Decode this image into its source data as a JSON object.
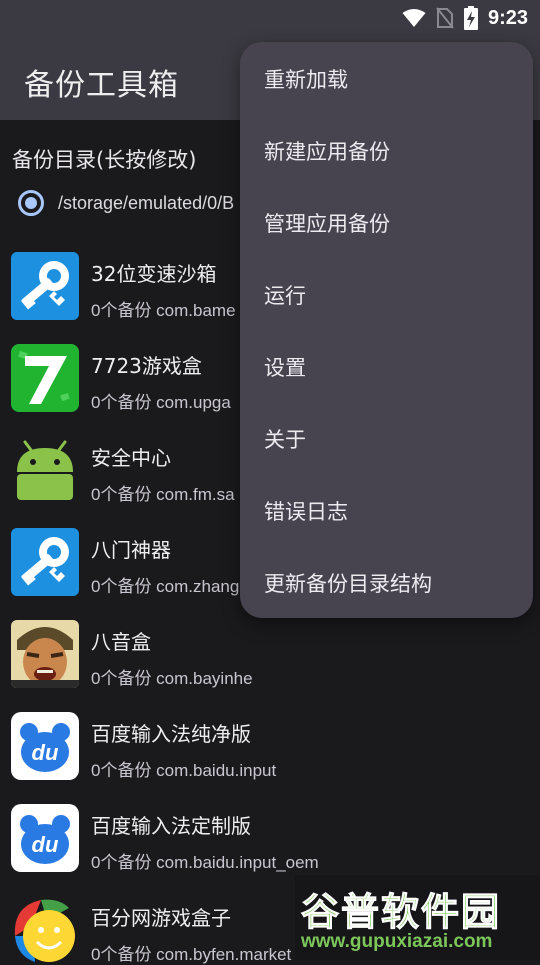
{
  "status_bar": {
    "time": "9:23"
  },
  "app_bar": {
    "title": "备份工具箱"
  },
  "backup_dir": {
    "label": "备份目录(长按修改)",
    "path": "/storage/emulated/0/B"
  },
  "apps": [
    {
      "name": "32位变速沙箱",
      "sub": "0个备份 com.bame",
      "icon": "key-wrench-icon"
    },
    {
      "name": "7723游戏盒",
      "sub": "0个备份 com.upga",
      "icon": "seven-game-icon"
    },
    {
      "name": "安全中心",
      "sub": "0个备份 com.fm.sa",
      "icon": "android-icon"
    },
    {
      "name": "八门神器",
      "sub": "0个备份 com.zhang",
      "icon": "key-wrench-icon"
    },
    {
      "name": "八音盒",
      "sub": "0个备份 com.bayinhe",
      "icon": "character-face-icon"
    },
    {
      "name": "百度输入法纯净版",
      "sub": "0个备份 com.baidu.input",
      "icon": "baidu-input-icon"
    },
    {
      "name": "百度输入法定制版",
      "sub": "0个备份 com.baidu.input_oem",
      "icon": "baidu-input-icon"
    },
    {
      "name": "百分网游戏盒子",
      "sub": "0个备份 com.byfen.market",
      "icon": "smiley-ball-icon"
    }
  ],
  "menu": {
    "items": [
      "重新加载",
      "新建应用备份",
      "管理应用备份",
      "运行",
      "设置",
      "关于",
      "错误日志",
      "更新备份目录结构"
    ]
  },
  "watermark": {
    "title": "谷普软件园",
    "url": "www.gupuxiazai.com"
  },
  "colors": {
    "accent": "#a8c7fa",
    "app_bar": "#3b3a42",
    "menu": "#47434f",
    "background": "#1a1a1d"
  }
}
